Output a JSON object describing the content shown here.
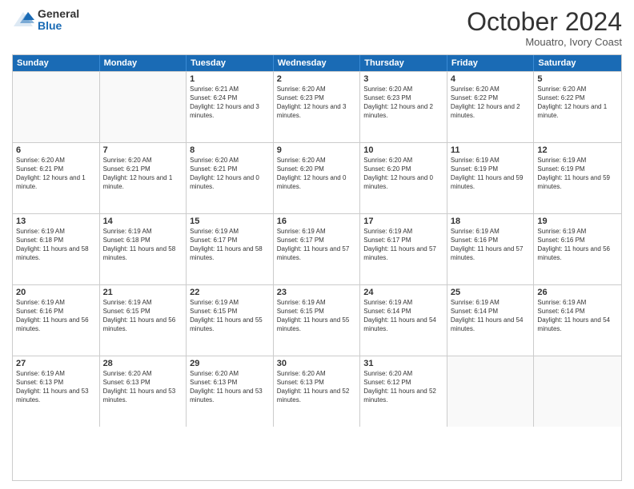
{
  "logo": {
    "general": "General",
    "blue": "Blue"
  },
  "header": {
    "month": "October 2024",
    "location": "Mouatro, Ivory Coast"
  },
  "days": [
    "Sunday",
    "Monday",
    "Tuesday",
    "Wednesday",
    "Thursday",
    "Friday",
    "Saturday"
  ],
  "weeks": [
    [
      {
        "day": "",
        "empty": true
      },
      {
        "day": "",
        "empty": true
      },
      {
        "day": "1",
        "sunrise": "6:21 AM",
        "sunset": "6:24 PM",
        "daylight": "12 hours and 3 minutes."
      },
      {
        "day": "2",
        "sunrise": "6:20 AM",
        "sunset": "6:23 PM",
        "daylight": "12 hours and 3 minutes."
      },
      {
        "day": "3",
        "sunrise": "6:20 AM",
        "sunset": "6:23 PM",
        "daylight": "12 hours and 2 minutes."
      },
      {
        "day": "4",
        "sunrise": "6:20 AM",
        "sunset": "6:22 PM",
        "daylight": "12 hours and 2 minutes."
      },
      {
        "day": "5",
        "sunrise": "6:20 AM",
        "sunset": "6:22 PM",
        "daylight": "12 hours and 1 minute."
      }
    ],
    [
      {
        "day": "6",
        "sunrise": "6:20 AM",
        "sunset": "6:21 PM",
        "daylight": "12 hours and 1 minute."
      },
      {
        "day": "7",
        "sunrise": "6:20 AM",
        "sunset": "6:21 PM",
        "daylight": "12 hours and 1 minute."
      },
      {
        "day": "8",
        "sunrise": "6:20 AM",
        "sunset": "6:21 PM",
        "daylight": "12 hours and 0 minutes."
      },
      {
        "day": "9",
        "sunrise": "6:20 AM",
        "sunset": "6:20 PM",
        "daylight": "12 hours and 0 minutes."
      },
      {
        "day": "10",
        "sunrise": "6:20 AM",
        "sunset": "6:20 PM",
        "daylight": "12 hours and 0 minutes."
      },
      {
        "day": "11",
        "sunrise": "6:19 AM",
        "sunset": "6:19 PM",
        "daylight": "11 hours and 59 minutes."
      },
      {
        "day": "12",
        "sunrise": "6:19 AM",
        "sunset": "6:19 PM",
        "daylight": "11 hours and 59 minutes."
      }
    ],
    [
      {
        "day": "13",
        "sunrise": "6:19 AM",
        "sunset": "6:18 PM",
        "daylight": "11 hours and 58 minutes."
      },
      {
        "day": "14",
        "sunrise": "6:19 AM",
        "sunset": "6:18 PM",
        "daylight": "11 hours and 58 minutes."
      },
      {
        "day": "15",
        "sunrise": "6:19 AM",
        "sunset": "6:17 PM",
        "daylight": "11 hours and 58 minutes."
      },
      {
        "day": "16",
        "sunrise": "6:19 AM",
        "sunset": "6:17 PM",
        "daylight": "11 hours and 57 minutes."
      },
      {
        "day": "17",
        "sunrise": "6:19 AM",
        "sunset": "6:17 PM",
        "daylight": "11 hours and 57 minutes."
      },
      {
        "day": "18",
        "sunrise": "6:19 AM",
        "sunset": "6:16 PM",
        "daylight": "11 hours and 57 minutes."
      },
      {
        "day": "19",
        "sunrise": "6:19 AM",
        "sunset": "6:16 PM",
        "daylight": "11 hours and 56 minutes."
      }
    ],
    [
      {
        "day": "20",
        "sunrise": "6:19 AM",
        "sunset": "6:16 PM",
        "daylight": "11 hours and 56 minutes."
      },
      {
        "day": "21",
        "sunrise": "6:19 AM",
        "sunset": "6:15 PM",
        "daylight": "11 hours and 56 minutes."
      },
      {
        "day": "22",
        "sunrise": "6:19 AM",
        "sunset": "6:15 PM",
        "daylight": "11 hours and 55 minutes."
      },
      {
        "day": "23",
        "sunrise": "6:19 AM",
        "sunset": "6:15 PM",
        "daylight": "11 hours and 55 minutes."
      },
      {
        "day": "24",
        "sunrise": "6:19 AM",
        "sunset": "6:14 PM",
        "daylight": "11 hours and 54 minutes."
      },
      {
        "day": "25",
        "sunrise": "6:19 AM",
        "sunset": "6:14 PM",
        "daylight": "11 hours and 54 minutes."
      },
      {
        "day": "26",
        "sunrise": "6:19 AM",
        "sunset": "6:14 PM",
        "daylight": "11 hours and 54 minutes."
      }
    ],
    [
      {
        "day": "27",
        "sunrise": "6:19 AM",
        "sunset": "6:13 PM",
        "daylight": "11 hours and 53 minutes."
      },
      {
        "day": "28",
        "sunrise": "6:20 AM",
        "sunset": "6:13 PM",
        "daylight": "11 hours and 53 minutes."
      },
      {
        "day": "29",
        "sunrise": "6:20 AM",
        "sunset": "6:13 PM",
        "daylight": "11 hours and 53 minutes."
      },
      {
        "day": "30",
        "sunrise": "6:20 AM",
        "sunset": "6:13 PM",
        "daylight": "11 hours and 52 minutes."
      },
      {
        "day": "31",
        "sunrise": "6:20 AM",
        "sunset": "6:12 PM",
        "daylight": "11 hours and 52 minutes."
      },
      {
        "day": "",
        "empty": true
      },
      {
        "day": "",
        "empty": true
      }
    ]
  ]
}
